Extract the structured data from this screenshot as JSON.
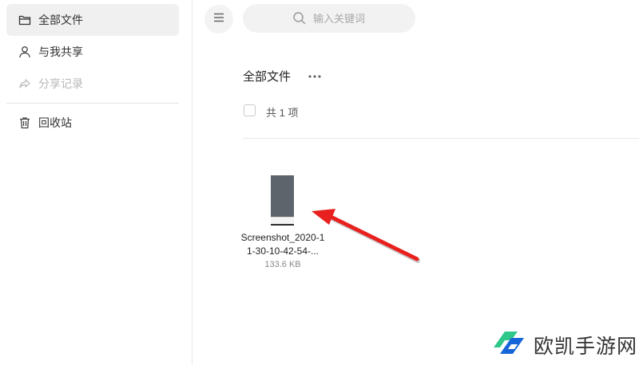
{
  "sidebar": {
    "items": [
      {
        "label": "全部文件",
        "icon": "folder-icon",
        "state": "active"
      },
      {
        "label": "与我共享",
        "icon": "user-icon",
        "state": "normal"
      },
      {
        "label": "分享记录",
        "icon": "share-icon",
        "state": "disabled"
      },
      {
        "label": "回收站",
        "icon": "trash-icon",
        "state": "normal"
      }
    ]
  },
  "topbar": {
    "menu_icon": "hamburger-icon",
    "search_placeholder": "输入关键词"
  },
  "main": {
    "title": "全部文件",
    "count_text": "共 1 项",
    "files": [
      {
        "name": "Screenshot_2020-11-30-10-42-54-...",
        "size": "133.6 KB"
      }
    ]
  },
  "watermark": {
    "text": "欧凯手游网"
  },
  "colors": {
    "accent_arrow": "#e8201e",
    "brand_blue": "#1565d8",
    "brand_green": "#2fc88a"
  }
}
